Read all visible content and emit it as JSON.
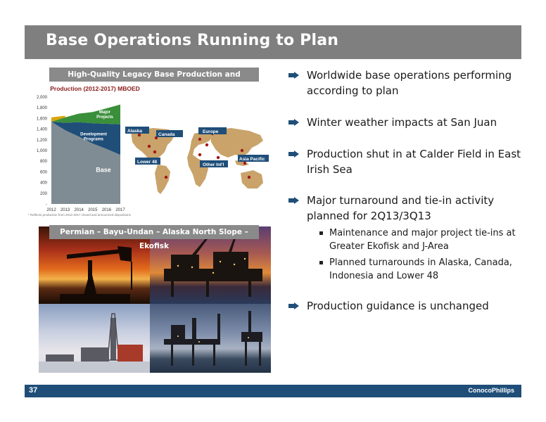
{
  "slide": {
    "title": "Base Operations Running to Plan",
    "page_number": "37",
    "logo_text": "ConocoPhillips"
  },
  "left_panel": {
    "chart_header": "High-Quality Legacy Base Production and Capability",
    "photos_header": "Permian – Bayu-Undan – Alaska North Slope – Ekofisk",
    "footnote": "* Reflects production from 2012-2017 closed and announced dispositions"
  },
  "chart_data": {
    "type": "area",
    "title": "Production (2012-2017) MBOED",
    "x": [
      "2012",
      "2013",
      "2014",
      "2015",
      "2016",
      "2017"
    ],
    "ylim": [
      0,
      2000
    ],
    "yticks": [
      "2,000",
      "1,800",
      "1,600",
      "1,400",
      "1,200",
      "1,000",
      "800",
      "600",
      "400",
      "200",
      "-"
    ],
    "series": [
      {
        "name": "Base",
        "values": [
          1540,
          1380,
          1260,
          1130,
          1030,
          920
        ],
        "color": "#7f8c93"
      },
      {
        "name": "Development Programs",
        "values": [
          0,
          140,
          270,
          380,
          470,
          570
        ],
        "color": "#1f4e79"
      },
      {
        "name": "Major Projects",
        "values": [
          0,
          100,
          160,
          210,
          290,
          370
        ],
        "color": "#3a8f3a"
      }
    ],
    "top_band_color": "#d9a400"
  },
  "map": {
    "labels": [
      "Alaska",
      "Canada",
      "Europe",
      "Lower 48",
      "Other Int'l",
      "Asia Pacific"
    ],
    "label_color": "#1f4e79"
  },
  "bullets": [
    {
      "text": "Worldwide base operations performing according to plan"
    },
    {
      "text": "Winter weather impacts at San Juan"
    },
    {
      "text": "Production shut in at Calder Field in East Irish Sea"
    },
    {
      "text": "Major turnaround and tie-in activity planned for 2Q13/3Q13"
    },
    {
      "text": "Production guidance is unchanged"
    }
  ],
  "sub_bullets": [
    {
      "text": "Maintenance and major project tie-ins at Greater Ekofisk and J-Area"
    },
    {
      "text": "Planned turnarounds in Alaska, Canada, Indonesia and Lower 48"
    }
  ],
  "colors": {
    "arrow": "#1f4e79",
    "title_bar": "#7f7f7f",
    "footer": "#1f4e79"
  }
}
